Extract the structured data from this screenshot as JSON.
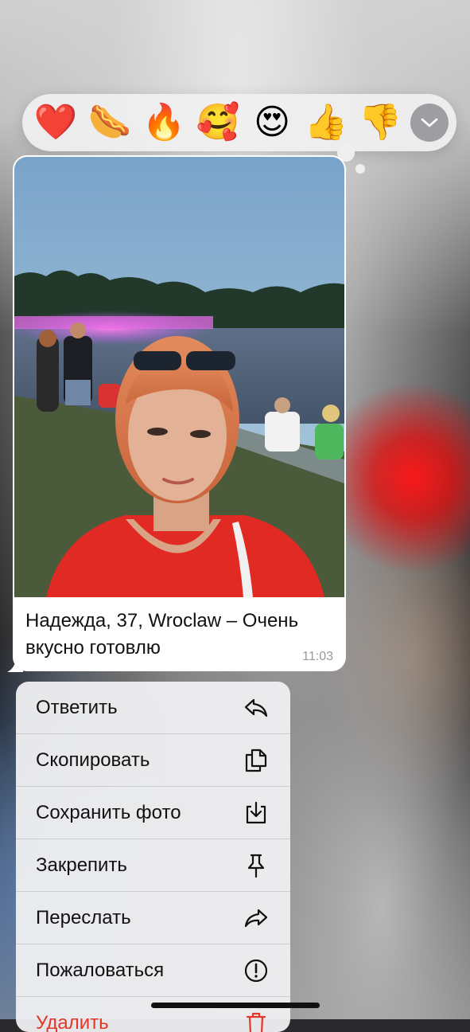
{
  "reactions": {
    "items": [
      {
        "name": "red-heart",
        "glyph": "❤️"
      },
      {
        "name": "hot-dog",
        "glyph": "🌭"
      },
      {
        "name": "fire",
        "glyph": "🔥"
      },
      {
        "name": "smiling-face-with-hearts",
        "glyph": "🥰"
      },
      {
        "name": "heart-eyes",
        "glyph": "😍"
      },
      {
        "name": "thumbs-up",
        "glyph": "👍"
      },
      {
        "name": "thumbs-down",
        "glyph": "👎"
      }
    ],
    "more_icon": "chevron-down-icon"
  },
  "message": {
    "photo_icon": "selfie-photo",
    "caption": "Надежда, 37, Wroclaw – Очень вкусно готовлю",
    "time": "11:03"
  },
  "menu": {
    "items": [
      {
        "label": "Ответить",
        "icon": "reply-icon"
      },
      {
        "label": "Скопировать",
        "icon": "copy-icon"
      },
      {
        "label": "Сохранить фото",
        "icon": "save-photo-icon"
      },
      {
        "label": "Закрепить",
        "icon": "pin-icon"
      },
      {
        "label": "Переслать",
        "icon": "forward-icon"
      },
      {
        "label": "Пожаловаться",
        "icon": "report-icon"
      },
      {
        "label": "Удалить",
        "icon": "trash-icon"
      }
    ]
  },
  "colors": {
    "accent_red": "#e2362b",
    "bubble": "#ffffff",
    "menu_bg": "#eeeef0"
  }
}
